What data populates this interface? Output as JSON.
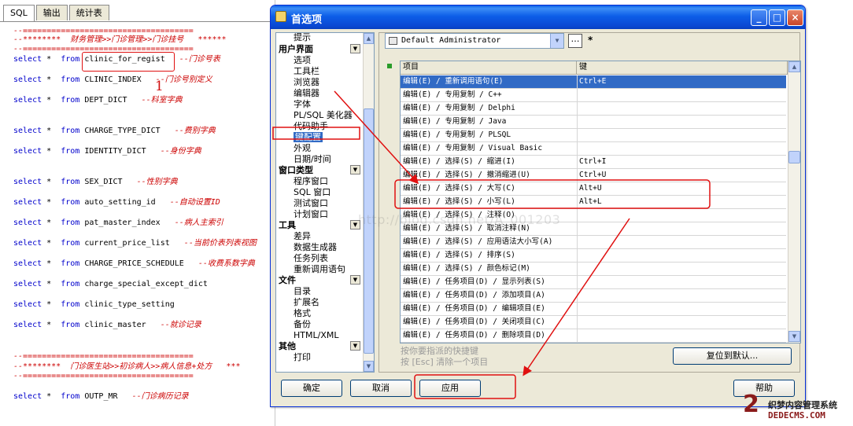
{
  "editor": {
    "tabs": [
      "SQL",
      "输出",
      "统计表"
    ],
    "annotation_number": "1",
    "lines": [
      {
        "type": "comment",
        "text": "--===================================="
      },
      {
        "type": "comment",
        "text": "--********  财务管理>>门诊管理>>门诊挂号   ******"
      },
      {
        "type": "comment",
        "text": "--===================================="
      },
      {
        "type": "stmt",
        "kw1": "select",
        "star": "*",
        "kw2": "from",
        "table": "clinic_for_regist",
        "comment": "--门诊号表"
      },
      {
        "type": "stmt",
        "kw1": "select",
        "star": "*",
        "kw2": "from",
        "table": "CLINIC_INDEX",
        "comment": "--门诊号别定义"
      },
      {
        "type": "stmt",
        "kw1": "select",
        "star": "*",
        "kw2": "from",
        "table": "DEPT_DICT",
        "comment": "--科室字典"
      },
      {
        "type": "stmt",
        "kw1": "select",
        "star": "*",
        "kw2": "from",
        "table": "CHARGE_TYPE_DICT",
        "comment": "--费别字典"
      },
      {
        "type": "stmt",
        "kw1": "select",
        "star": "*",
        "kw2": "from",
        "table": "IDENTITY_DICT",
        "comment": "--身份字典"
      },
      {
        "type": "stmt",
        "kw1": "select",
        "star": "*",
        "kw2": "from",
        "table": "SEX_DICT",
        "comment": "--性别字典"
      },
      {
        "type": "stmt",
        "kw1": "select",
        "star": "*",
        "kw2": "from",
        "table": "auto_setting_id",
        "comment": "--自动设置ID"
      },
      {
        "type": "stmt",
        "kw1": "select",
        "star": "*",
        "kw2": "from",
        "table": "pat_master_index",
        "comment": "--病人主索引"
      },
      {
        "type": "stmt",
        "kw1": "select",
        "star": "*",
        "kw2": "from",
        "table": "current_price_list",
        "comment": "--当前价表列表视图"
      },
      {
        "type": "stmt",
        "kw1": "select",
        "star": "*",
        "kw2": "from",
        "table": "CHARGE_PRICE_SCHEDULE",
        "comment": "--收费系数字典"
      },
      {
        "type": "stmt",
        "kw1": "select",
        "star": "*",
        "kw2": "from",
        "table": "charge_special_except_dict",
        "comment": ""
      },
      {
        "type": "stmt",
        "kw1": "select",
        "star": "*",
        "kw2": "from",
        "table": "clinic_type_setting",
        "comment": ""
      },
      {
        "type": "stmt",
        "kw1": "select",
        "star": "*",
        "kw2": "from",
        "table": "clinic_master",
        "comment": "--就诊记录"
      },
      {
        "type": "comment",
        "text": "--===================================="
      },
      {
        "type": "comment",
        "text": "--********  门诊医生站>>初诊病人>>病人信息+处方   ***"
      },
      {
        "type": "comment",
        "text": "--===================================="
      },
      {
        "type": "stmt",
        "kw1": "select",
        "star": "*",
        "kw2": "from",
        "table": "OUTP_MR",
        "comment": "--门诊病历记录"
      }
    ]
  },
  "dialog": {
    "title": "首选项",
    "controls": {
      "min": "_",
      "max": "□",
      "close": "×"
    },
    "tree": {
      "top_item": "提示",
      "categories": [
        {
          "label": "用户界面",
          "items": [
            "选项",
            "工具栏",
            "浏览器",
            "编辑器",
            "字体",
            "PL/SQL 美化器",
            "代码助手",
            "键配置",
            "外观",
            "日期/时间"
          ]
        },
        {
          "label": "窗口类型",
          "items": [
            "程序窗口",
            "SQL 窗口",
            "测试窗口",
            "计划窗口"
          ]
        },
        {
          "label": "工具",
          "items": [
            "差异",
            "数据生成器",
            "任务列表",
            "重新调用语句"
          ]
        },
        {
          "label": "文件",
          "items": [
            "目录",
            "扩展名",
            "格式",
            "备份",
            "HTML/XML"
          ]
        },
        {
          "label": "其他",
          "items": [
            "打印"
          ]
        }
      ],
      "selected_item": "键配置"
    },
    "profile": {
      "value": "Default Administrator",
      "more": "…",
      "star": "*"
    },
    "grid": {
      "headers": [
        "项目",
        "键"
      ],
      "rows": [
        [
          "编辑(E) / 重新调用语句(E)",
          "Ctrl+E"
        ],
        [
          "编辑(E) / 专用复制 / C++",
          ""
        ],
        [
          "编辑(E) / 专用复制 / Delphi",
          ""
        ],
        [
          "编辑(E) / 专用复制 / Java",
          ""
        ],
        [
          "编辑(E) / 专用复制 / PLSQL",
          ""
        ],
        [
          "编辑(E) / 专用复制 / Visual Basic",
          ""
        ],
        [
          "编辑(E) / 选择(S) / 缩进(I)",
          "Ctrl+I"
        ],
        [
          "编辑(E) / 选择(S) / 撤消缩进(U)",
          "Ctrl+U"
        ],
        [
          "编辑(E) / 选择(S) / 大写(C)",
          "Alt+U"
        ],
        [
          "编辑(E) / 选择(S) / 小写(L)",
          "Alt+L"
        ],
        [
          "编辑(E) / 选择(S) / 注释(O)",
          ""
        ],
        [
          "编辑(E) / 选择(S) / 取消注释(N)",
          ""
        ],
        [
          "编辑(E) / 选择(S) / 应用语法大小写(A)",
          ""
        ],
        [
          "编辑(E) / 选择(S) / 排序(S)",
          ""
        ],
        [
          "编辑(E) / 选择(S) / 颜色标记(M)",
          ""
        ],
        [
          "编辑(E) / 任务项目(D) / 显示列表(S)",
          ""
        ],
        [
          "编辑(E) / 任务项目(D) / 添加项目(A)",
          ""
        ],
        [
          "编辑(E) / 任务项目(D) / 编辑项目(E)",
          ""
        ],
        [
          "编辑(E) / 任务项目(D) / 关闭项目(C)",
          ""
        ],
        [
          "编辑(E) / 任务项目(D) / 删除项目(D)",
          ""
        ]
      ],
      "selected_row": 0
    },
    "hint_line1": "按你要指派的快捷键",
    "hint_line2": "按 [Esc] 清除一个项目",
    "buttons": {
      "reset": "复位到默认...",
      "ok": "确定",
      "cancel": "取消",
      "apply": "应用",
      "help": "帮助"
    }
  },
  "watermark": {
    "text": "http://blog.csdn.net/A_001203",
    "logo_mark": "2",
    "logo_line1": "织梦内容管理系统",
    "logo_line2": "DEDECMS.COM"
  },
  "colors": {
    "annotation": "#e01010",
    "selection": "#316ac5",
    "titlebar": "#0a49d4"
  }
}
